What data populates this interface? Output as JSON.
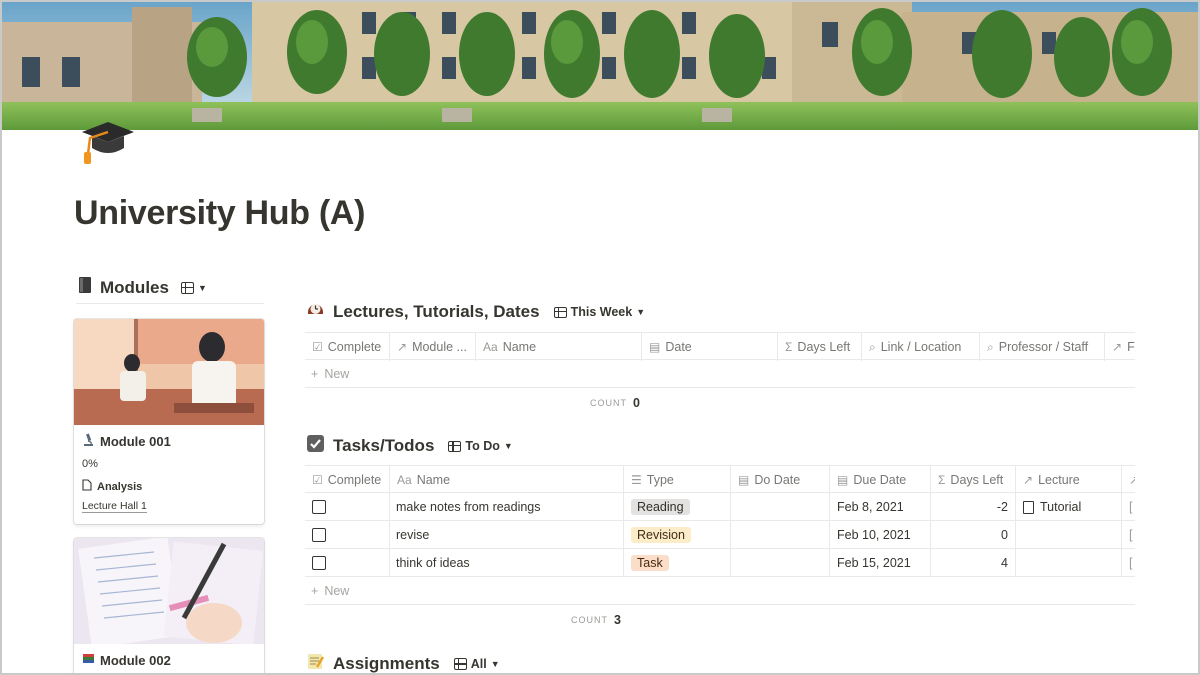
{
  "cover": {
    "description_icon": "campus-cover-image"
  },
  "page": {
    "icon": "graduation-cap-icon",
    "title": "University Hub (A)"
  },
  "modules": {
    "icon": "notebook-icon",
    "title": "Modules",
    "view_icon": "gallery-icon",
    "cards": [
      {
        "icon": "microscope-icon",
        "title": "Module 001",
        "progress": "0%",
        "tag_icon": "page-icon",
        "tag_text": "Analysis",
        "location": "Lecture Hall 1"
      },
      {
        "icon": "books-icon",
        "title": "Module 002"
      }
    ]
  },
  "lectures": {
    "icon": "clock-icon",
    "title": "Lectures, Tutorials, Dates",
    "view_label": "This Week",
    "columns": [
      {
        "icon": "checkbox-icon",
        "label": "Complete"
      },
      {
        "icon": "relation-arrow-icon",
        "label": "Module ..."
      },
      {
        "icon": "text-icon",
        "label": "Name"
      },
      {
        "icon": "calendar-icon",
        "label": "Date"
      },
      {
        "icon": "sigma-icon",
        "label": "Days Left"
      },
      {
        "icon": "search-icon",
        "label": "Link / Location"
      },
      {
        "icon": "search-icon",
        "label": "Professor / Staff"
      },
      {
        "icon": "relation-arrow-icon",
        "label": "F"
      }
    ],
    "new_label": "New",
    "count_label": "COUNT",
    "count_value": "0"
  },
  "tasks": {
    "icon": "checkmark-box-icon",
    "title": "Tasks/Todos",
    "view_label": "To Do",
    "columns": [
      {
        "icon": "checkbox-icon",
        "label": "Complete"
      },
      {
        "icon": "text-icon",
        "label": "Name"
      },
      {
        "icon": "list-icon",
        "label": "Type"
      },
      {
        "icon": "calendar-icon",
        "label": "Do Date"
      },
      {
        "icon": "calendar-icon",
        "label": "Due Date"
      },
      {
        "icon": "sigma-icon",
        "label": "Days Left"
      },
      {
        "icon": "relation-arrow-icon",
        "label": "Lecture"
      },
      {
        "icon": "relation-arrow-icon",
        "label": ""
      }
    ],
    "rows": [
      {
        "name": "make notes from readings",
        "type": "Reading",
        "due": "Feb 8, 2021",
        "days_left": "-2",
        "lecture": "Tutorial"
      },
      {
        "name": "revise",
        "type": "Revision",
        "due": "Feb 10, 2021",
        "days_left": "0",
        "lecture": ""
      },
      {
        "name": "think of ideas",
        "type": "Task",
        "due": "Feb 15, 2021",
        "days_left": "4",
        "lecture": ""
      }
    ],
    "new_label": "New",
    "count_label": "COUNT",
    "count_value": "3"
  },
  "assignments": {
    "icon": "memo-icon",
    "title": "Assignments",
    "view_label": "All"
  },
  "colors": {
    "text": "#37352f",
    "muted": "#787774",
    "border": "#e9e9e7",
    "tag_reading": "#e3e2e0",
    "tag_revision": "#fdecc8",
    "tag_task": "#fadec9"
  }
}
